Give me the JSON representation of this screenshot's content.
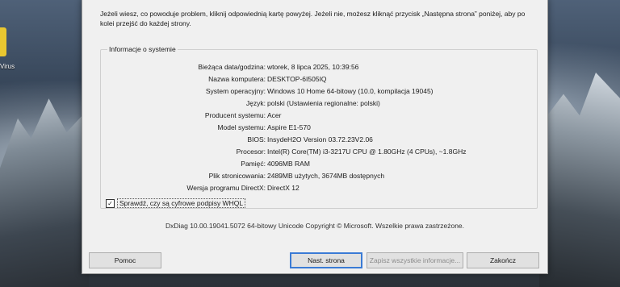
{
  "desktop": {
    "icon_label": "Virus"
  },
  "intro_text": "Jeżeli wiesz, co powoduje problem, kliknij odpowiednią kartę powyżej. Jeżeli nie, możesz kliknąć przycisk „Następna strona” poniżej, aby po kolei przejść do każdej strony.",
  "system_info": {
    "title": "Informacje o systemie",
    "rows": [
      {
        "label": "Bieżąca data/godzina:",
        "value": "wtorek, 8 lipca 2025, 10:39:56"
      },
      {
        "label": "Nazwa komputera:",
        "value": "DESKTOP-6I505IQ"
      },
      {
        "label": "System operacyjny:",
        "value": "Windows 10 Home 64-bitowy (10.0, kompilacja 19045)"
      },
      {
        "label": "Język:",
        "value": "polski (Ustawienia regionalne: polski)"
      },
      {
        "label": "Producent systemu:",
        "value": "Acer"
      },
      {
        "label": "Model systemu:",
        "value": "Aspire E1-570"
      },
      {
        "label": "BIOS:",
        "value": "InsydeH2O Version 03.72.23V2.06"
      },
      {
        "label": "Procesor:",
        "value": "Intel(R) Core(TM) i3-3217U CPU @ 1.80GHz (4 CPUs), ~1.8GHz"
      },
      {
        "label": "Pamięć:",
        "value": "4096MB RAM"
      },
      {
        "label": "Plik stronicowania:",
        "value": "2489MB użytych, 3674MB dostępnych"
      },
      {
        "label": "Wersja programu DirectX:",
        "value": "DirectX 12"
      }
    ],
    "whql_label": "Sprawdź, czy są cyfrowe podpisy WHQL",
    "whql_checked": "✓"
  },
  "copyright": "DxDiag 10.00.19041.5072 64-bitowy Unicode  Copyright © Microsoft. Wszelkie prawa zastrzeżone.",
  "buttons": {
    "help": "Pomoc",
    "next_page": "Nast. strona",
    "save_all": "Zapisz wszystkie informacje...",
    "exit": "Zakończ"
  }
}
